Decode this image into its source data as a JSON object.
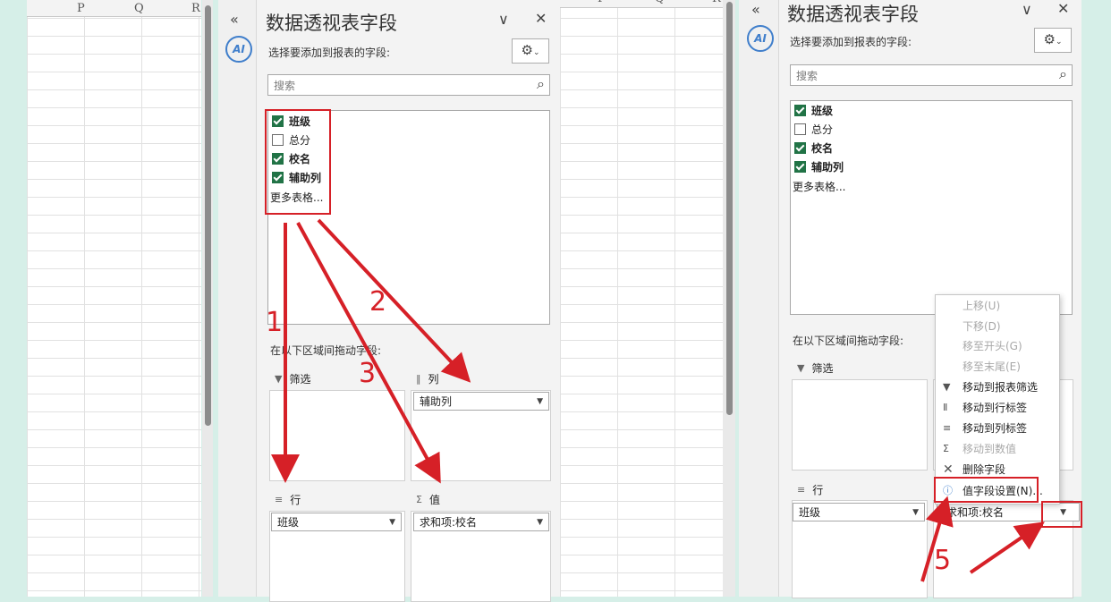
{
  "left_sheet": {
    "cols": [
      "P",
      "Q",
      "R"
    ]
  },
  "mid_sheet": {
    "cols": [
      "P",
      "Q",
      "R"
    ]
  },
  "left_panel": {
    "title": "数据透视表字段",
    "subtitle": "选择要添加到报表的字段:",
    "search_placeholder": "搜索",
    "fields": [
      {
        "label": "班级",
        "checked": true
      },
      {
        "label": "总分",
        "checked": false
      },
      {
        "label": "校名",
        "checked": true
      },
      {
        "label": "辅助列",
        "checked": true
      }
    ],
    "more_tables": "更多表格...",
    "drag_label": "在以下区域间拖动字段:",
    "areas": {
      "filter": {
        "label": "筛选"
      },
      "columns": {
        "label": "列",
        "value": "辅助列"
      },
      "rows": {
        "label": "行",
        "value": "班级"
      },
      "values": {
        "label": "值",
        "value": "求和项:校名"
      }
    },
    "annotations": [
      "1",
      "2",
      "3"
    ]
  },
  "right_panel": {
    "title": "数据透视表字段",
    "subtitle": "选择要添加到报表的字段:",
    "search_placeholder": "搜索",
    "fields": [
      {
        "label": "班级",
        "checked": true
      },
      {
        "label": "总分",
        "checked": false
      },
      {
        "label": "校名",
        "checked": true
      },
      {
        "label": "辅助列",
        "checked": true
      }
    ],
    "more_tables": "更多表格...",
    "drag_label": "在以下区域间拖动字段:",
    "areas": {
      "filter": {
        "label": "筛选"
      },
      "rows": {
        "label": "行",
        "value": "班级"
      },
      "values": {
        "value": "求和项:校名"
      }
    },
    "menu": [
      {
        "label": "上移(U)",
        "enabled": false,
        "icon": ""
      },
      {
        "label": "下移(D)",
        "enabled": false,
        "icon": ""
      },
      {
        "label": "移至开头(G)",
        "enabled": false,
        "icon": ""
      },
      {
        "label": "移至末尾(E)",
        "enabled": false,
        "icon": ""
      },
      {
        "label": "移动到报表筛选",
        "enabled": true,
        "icon": "filter-icon"
      },
      {
        "label": "移动到行标签",
        "enabled": true,
        "icon": "rows-icon"
      },
      {
        "label": "移动到列标签",
        "enabled": true,
        "icon": "columns-icon"
      },
      {
        "label": "移动到数值",
        "enabled": false,
        "icon": "sigma-icon"
      },
      {
        "label": "删除字段",
        "enabled": true,
        "icon": "close-icon"
      },
      {
        "label": "值字段设置(N)...",
        "enabled": true,
        "icon": "field-settings-icon"
      }
    ],
    "annotations": [
      "5"
    ]
  },
  "colors": {
    "accent_red": "#d62027",
    "checkbox_green": "#217346",
    "ai_blue": "#3f7ecb"
  }
}
